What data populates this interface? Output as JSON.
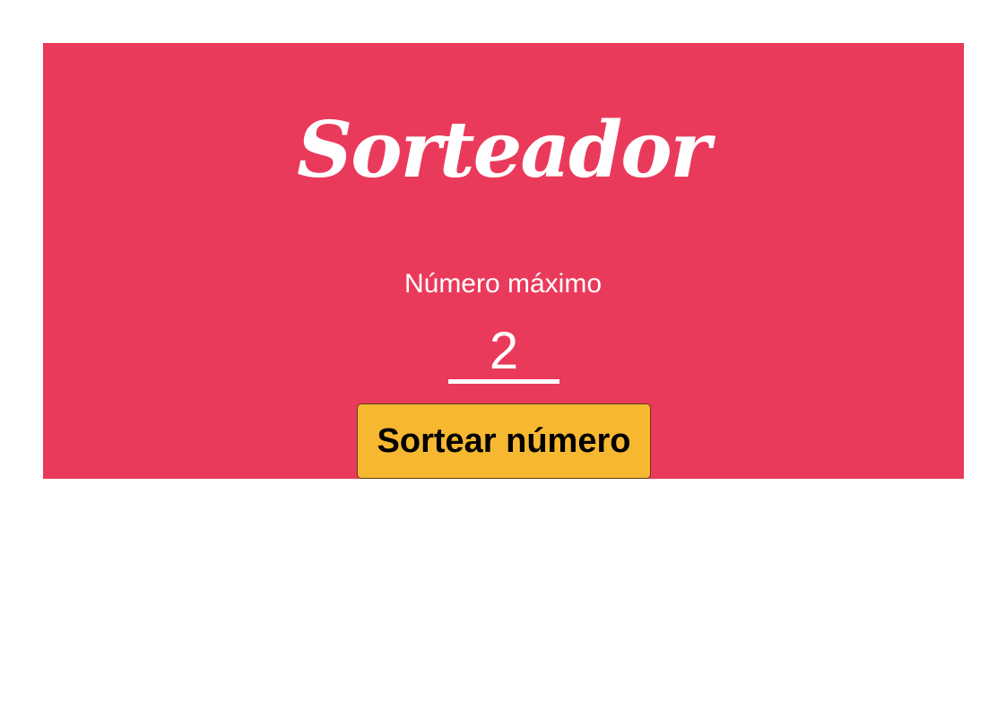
{
  "colors": {
    "panel_background": "#EA3A5B",
    "button_background": "#F6B731",
    "text_light": "#FFFFFF",
    "text_dark": "#000000"
  },
  "header": {
    "title": "Sorteador"
  },
  "form": {
    "max_label": "Número máximo",
    "max_value": "2",
    "button_label": "Sortear número"
  }
}
